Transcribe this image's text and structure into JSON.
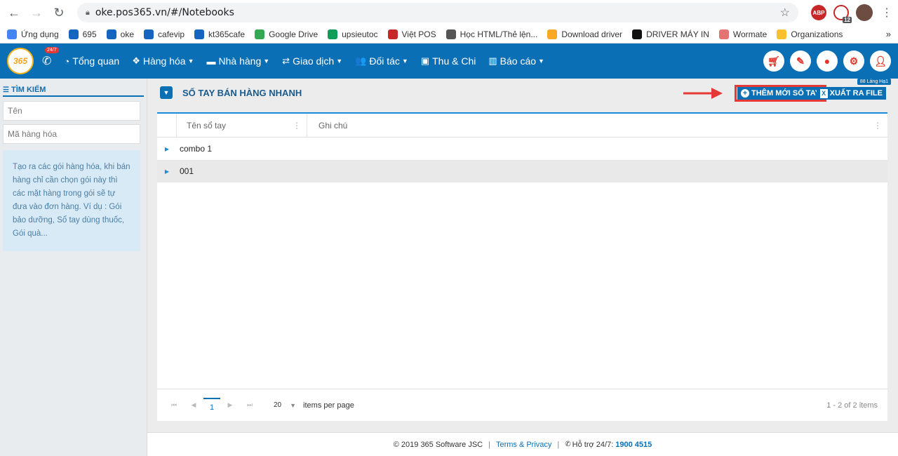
{
  "browser": {
    "url": "oke.pos365.vn/#/Notebooks",
    "ext_badge_count": "12"
  },
  "bookmarks": [
    {
      "label": "Ứng dụng",
      "color": "#4285f4",
      "icon": "apps-grid-icon"
    },
    {
      "label": "695",
      "color": "#1565c0",
      "icon": "pos365-icon"
    },
    {
      "label": "oke",
      "color": "#1565c0",
      "icon": "pos365-icon"
    },
    {
      "label": "cafevip",
      "color": "#1565c0",
      "icon": "pos365-icon"
    },
    {
      "label": "kt365cafe",
      "color": "#1565c0",
      "icon": "pos365-icon"
    },
    {
      "label": "Google Drive",
      "color": "#34a853",
      "icon": "google-drive-icon"
    },
    {
      "label": "upsieutoc",
      "color": "#0f9d58",
      "icon": "upload-icon"
    },
    {
      "label": "Việt POS",
      "color": "#c62828",
      "icon": "vietpos-icon"
    },
    {
      "label": "Học HTML/Thẻ lện...",
      "color": "#555555",
      "icon": "html-icon"
    },
    {
      "label": "Download driver",
      "color": "#f9a825",
      "icon": "download-icon"
    },
    {
      "label": "DRIVER MÁY IN",
      "color": "#111111",
      "icon": "v-logo-icon"
    },
    {
      "label": "Wormate",
      "color": "#e57373",
      "icon": "wormate-icon"
    },
    {
      "label": "Organizations",
      "color": "#fbc02d",
      "icon": "organizations-icon"
    }
  ],
  "app": {
    "logo_text": "365",
    "support_badge": "24/7",
    "menu": [
      {
        "label": "Tổng quan",
        "icon": "dashboard-icon",
        "glyph": "◔",
        "dropdown": false
      },
      {
        "label": "Hàng hóa",
        "icon": "cubes-icon",
        "glyph": "❖",
        "dropdown": true
      },
      {
        "label": "Nhà hàng",
        "icon": "restaurant-icon",
        "glyph": "▬",
        "dropdown": true
      },
      {
        "label": "Giao dịch",
        "icon": "exchange-icon",
        "glyph": "⇄",
        "dropdown": true
      },
      {
        "label": "Đối tác",
        "icon": "users-icon",
        "glyph": "👥",
        "dropdown": true
      },
      {
        "label": "Thu & Chi",
        "icon": "money-icon",
        "glyph": "▣",
        "dropdown": false
      },
      {
        "label": "Báo cáo",
        "icon": "bar-chart-icon",
        "glyph": "▥",
        "dropdown": true
      }
    ],
    "location": "88 Láng Hạ1"
  },
  "sidebar": {
    "title": "TÌM KIẾM",
    "name_placeholder": "Tên",
    "code_placeholder": "Mã hàng hóa",
    "help": "Tạo ra các gói hàng hóa, khi bán hàng chỉ cần chọn gói này thì các mặt hàng trong gói sẽ tự đưa vào đơn hàng. Ví dụ : Gói bảo dưỡng, Sổ tay dùng thuốc, Gói quà..."
  },
  "page": {
    "title": "SỔ TAY BÁN HÀNG NHANH",
    "add_label": "THÊM MỚI SỔ TAY",
    "export_label": "XUẤT RA FILE"
  },
  "grid": {
    "columns": [
      "Tên sổ tay",
      "Ghi chú"
    ],
    "rows": [
      {
        "name": "combo 1",
        "note": ""
      },
      {
        "name": "001",
        "note": ""
      }
    ]
  },
  "pager": {
    "current_page": "1",
    "page_size": "20",
    "per_page_label": "items per page",
    "summary": "1 - 2 of 2 items"
  },
  "footer": {
    "copyright": "© 2019 365 Software JSC",
    "terms": "Terms & Privacy",
    "support_label": "Hỗ trợ 24/7:",
    "hotline": "1900 4515"
  }
}
